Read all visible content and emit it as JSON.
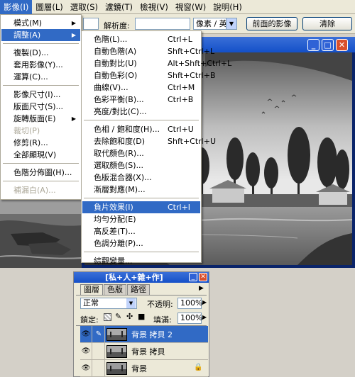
{
  "menubar": [
    {
      "label": "影像(I)",
      "active": true
    },
    {
      "label": "圖層(L)"
    },
    {
      "label": "選取(S)"
    },
    {
      "label": "濾鏡(T)"
    },
    {
      "label": "檢視(V)"
    },
    {
      "label": "視窗(W)"
    },
    {
      "label": "說明(H)"
    }
  ],
  "options_bar": {
    "resolution_label": "解析度:",
    "resolution_value": "",
    "units_value": "像素 / 英寸",
    "front_image_button": "前面的影像",
    "clear_button": "清除"
  },
  "image_menu": {
    "items": [
      {
        "label": "模式(M)",
        "submenu": true
      },
      {
        "label": "調整(A)",
        "submenu": true,
        "highlight": true
      },
      {
        "separator": true
      },
      {
        "label": "複製(D)..."
      },
      {
        "label": "套用影像(Y)..."
      },
      {
        "label": "運算(C)..."
      },
      {
        "separator": true
      },
      {
        "label": "影像尺寸(I)..."
      },
      {
        "label": "版面尺寸(S)..."
      },
      {
        "label": "旋轉版面(E)",
        "submenu": true
      },
      {
        "label": "裁切(P)",
        "disabled": true
      },
      {
        "label": "修剪(R)..."
      },
      {
        "label": "全部顯現(V)"
      },
      {
        "separator": true
      },
      {
        "label": "色階分佈圖(H)..."
      },
      {
        "separator": true
      },
      {
        "label": "補漏白(A)...",
        "disabled": true
      }
    ]
  },
  "adjust_menu": {
    "items": [
      {
        "label": "色階(L)...",
        "shortcut": "Ctrl+L"
      },
      {
        "label": "自動色階(A)",
        "shortcut": "Shft+Ctrl+L"
      },
      {
        "label": "自動對比(U)",
        "shortcut": "Alt+Shft+Ctrl+L"
      },
      {
        "label": "自動色彩(O)",
        "shortcut": "Shft+Ctrl+B"
      },
      {
        "label": "曲線(V)...",
        "shortcut": "Ctrl+M"
      },
      {
        "label": "色彩平衡(B)...",
        "shortcut": "Ctrl+B"
      },
      {
        "label": "亮度/對比(C)..."
      },
      {
        "separator": true
      },
      {
        "label": "色相 / 飽和度(H)...",
        "shortcut": "Ctrl+U"
      },
      {
        "label": "去除飽和度(D)",
        "shortcut": "Shft+Ctrl+U"
      },
      {
        "label": "取代顏色(R)..."
      },
      {
        "label": "選取顏色(S)..."
      },
      {
        "label": "色版混合器(X)..."
      },
      {
        "label": "漸層對應(M)..."
      },
      {
        "separator": true
      },
      {
        "label": "負片效果(I)",
        "shortcut": "Ctrl+I",
        "highlight": true
      },
      {
        "label": "均勻分配(E)"
      },
      {
        "label": "高反差(T)..."
      },
      {
        "label": "色調分離(P)..."
      },
      {
        "separator": true
      },
      {
        "label": "綜觀變量..."
      }
    ]
  },
  "layers_panel": {
    "title": "[私+人+雜+作]",
    "tabs": [
      "圖層",
      "色版",
      "路徑"
    ],
    "blend_mode": "正常",
    "opacity_label": "不透明:",
    "opacity_value": "100%",
    "lock_label": "鎖定:",
    "fill_label": "填滿:",
    "fill_value": "100%",
    "layers": [
      {
        "name": "背景 拷貝 2",
        "selected": true
      },
      {
        "name": "背景 拷貝"
      },
      {
        "name": "背景",
        "locked": true
      }
    ]
  },
  "colors": {
    "highlight": "#316ac5",
    "titlebar": "#1450c8",
    "close_button": "#d94f2c"
  }
}
